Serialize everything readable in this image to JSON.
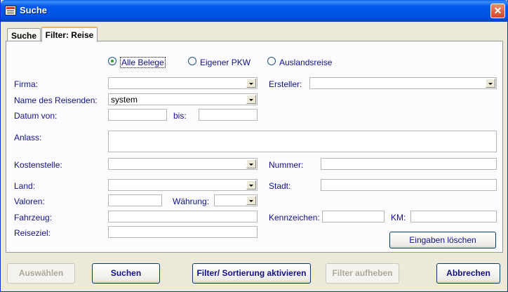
{
  "window": {
    "title": "Suche",
    "icon": "form-icon",
    "close_glyph": "✕"
  },
  "tabs": [
    {
      "label": "Suche",
      "active": false
    },
    {
      "label": "Filter: Reise",
      "active": true
    }
  ],
  "radios": [
    {
      "label": "Alle Belege",
      "selected": true
    },
    {
      "label": "Eigener PKW",
      "selected": false
    },
    {
      "label": "Auslandsreise",
      "selected": false
    }
  ],
  "fields": {
    "firma": {
      "label": "Firma:",
      "value": ""
    },
    "ersteller": {
      "label": "Ersteller:",
      "value": ""
    },
    "reisender": {
      "label": "Name des Reisenden:",
      "value": "system"
    },
    "datum_von": {
      "label": "Datum von:",
      "value": ""
    },
    "datum_bis": {
      "label": "bis:",
      "value": ""
    },
    "anlass": {
      "label": "Anlass:",
      "value": ""
    },
    "kostenstelle": {
      "label": "Kostenstelle:",
      "value": ""
    },
    "nummer": {
      "label": "Nummer:",
      "value": ""
    },
    "land": {
      "label": "Land:",
      "value": ""
    },
    "stadt": {
      "label": "Stadt:",
      "value": ""
    },
    "valoren": {
      "label": "Valoren:",
      "value": ""
    },
    "waehrung": {
      "label": "Währung:",
      "value": ""
    },
    "fahrzeug": {
      "label": "Fahrzeug:",
      "value": ""
    },
    "kennzeichen": {
      "label": "Kennzeichen:",
      "value": ""
    },
    "km": {
      "label": "KM:",
      "value": ""
    },
    "reiseziel": {
      "label": "Reiseziel:",
      "value": ""
    }
  },
  "buttons": {
    "clear": "Eingaben löschen",
    "select": "Auswählen",
    "search": "Suchen",
    "activate": "Filter/ Sortierung aktivieren",
    "remove": "Filter aufheben",
    "cancel": "Abbrechen"
  },
  "colors": {
    "label": "#10108c",
    "titlebar": "#0054e3",
    "face": "#ece9d8"
  }
}
